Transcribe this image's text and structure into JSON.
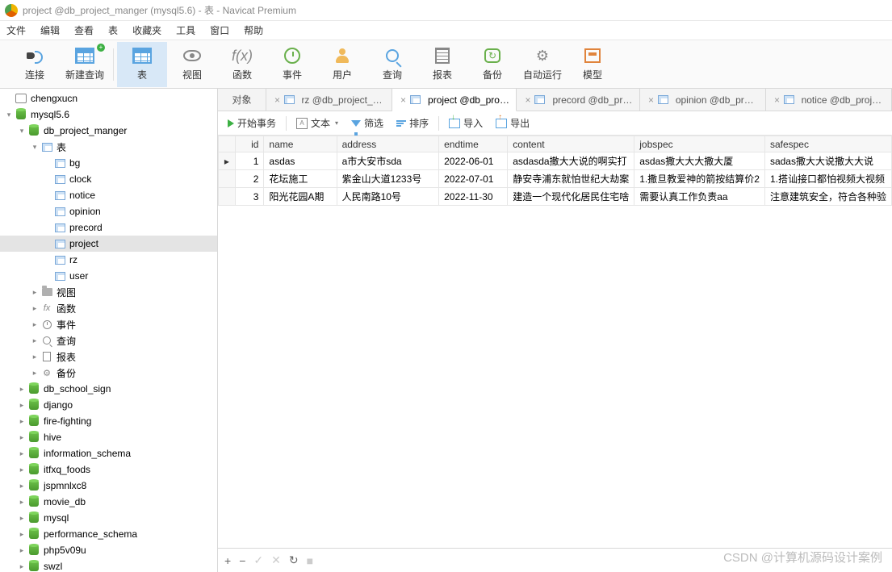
{
  "window": {
    "title": "project @db_project_manger (mysql5.6) - 表 - Navicat Premium"
  },
  "menu": [
    "文件",
    "编辑",
    "查看",
    "表",
    "收藏夹",
    "工具",
    "窗口",
    "帮助"
  ],
  "toolbar": [
    {
      "label": "连接",
      "icon": "plug"
    },
    {
      "label": "新建查询",
      "icon": "tbl-plus"
    },
    {
      "sep": true
    },
    {
      "label": "表",
      "icon": "big-tbl",
      "active": true
    },
    {
      "label": "视图",
      "icon": "eye"
    },
    {
      "label": "函数",
      "icon": "fx"
    },
    {
      "label": "事件",
      "icon": "clock"
    },
    {
      "label": "用户",
      "icon": "person"
    },
    {
      "label": "查询",
      "icon": "search"
    },
    {
      "label": "报表",
      "icon": "report"
    },
    {
      "label": "备份",
      "icon": "backup"
    },
    {
      "label": "自动运行",
      "icon": "auto"
    },
    {
      "label": "模型",
      "icon": "model"
    }
  ],
  "tree": {
    "conn": "chengxucn",
    "server": "mysql5.6",
    "db": "db_project_manger",
    "tables_label": "表",
    "tables": [
      "bg",
      "clock",
      "notice",
      "opinion",
      "precord",
      "project",
      "rz",
      "user"
    ],
    "groups": [
      {
        "label": "视图",
        "icon": "folder"
      },
      {
        "label": "函数",
        "icon": "fx"
      },
      {
        "label": "事件",
        "icon": "clock"
      },
      {
        "label": "查询",
        "icon": "search"
      },
      {
        "label": "报表",
        "icon": "doc"
      },
      {
        "label": "备份",
        "icon": "gear"
      }
    ],
    "other_dbs": [
      "db_school_sign",
      "django",
      "fire-fighting",
      "hive",
      "information_schema",
      "itfxq_foods",
      "jspmnlxc8",
      "movie_db",
      "mysql",
      "performance_schema",
      "php5v09u",
      "swzl"
    ]
  },
  "tabs": {
    "obj": "对象",
    "items": [
      {
        "label": "rz @db_project_ma..."
      },
      {
        "label": "project @db_proje...",
        "active": true
      },
      {
        "label": "precord @db_proj..."
      },
      {
        "label": "opinion @db_proje..."
      },
      {
        "label": "notice @db_project..."
      }
    ]
  },
  "subbar": {
    "begin": "开始事务",
    "text": "文本",
    "filter": "筛选",
    "sort": "排序",
    "import": "导入",
    "export": "导出"
  },
  "grid": {
    "headers": [
      "id",
      "name",
      "address",
      "endtime",
      "content",
      "jobspec",
      "safespec"
    ],
    "rows": [
      {
        "cur": true,
        "id": "1",
        "name": "asdas",
        "address": "a市大安市sda",
        "endtime": "2022-06-01",
        "content": "asdasda撒大大说的啊实打",
        "jobspec": "asdas撒大大大撒大厦",
        "safespec": "sadas撒大大说撒大大说"
      },
      {
        "id": "2",
        "name": "花坛施工",
        "address": "紫金山大道1233号",
        "endtime": "2022-07-01",
        "content": "静安寺浦东就怕世纪大劫案",
        "jobspec": "1.撒旦教爱神的箭按结算价2",
        "safespec": "1.搭讪接口都怕视频大视频"
      },
      {
        "id": "3",
        "name": "阳光花园A期",
        "address": "人民南路10号",
        "endtime": "2022-11-30",
        "content": "建造一个现代化居民住宅啥",
        "jobspec": "需要认真工作负责aa",
        "safespec": "注意建筑安全，符合各种验"
      }
    ]
  },
  "watermark": "CSDN @计算机源码设计案例"
}
